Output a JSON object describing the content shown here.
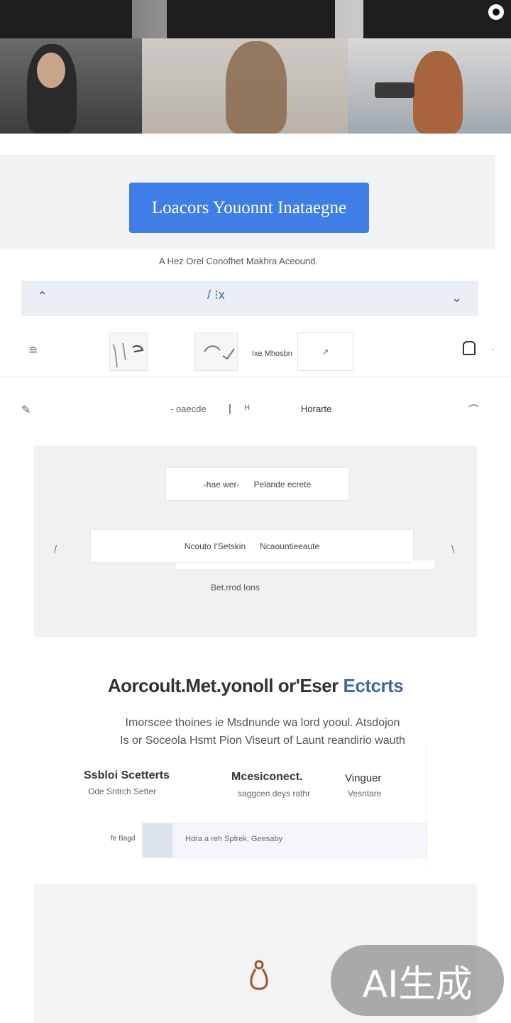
{
  "hero": {
    "alt_icon": "circle-dot-icon"
  },
  "cta": {
    "label": "Loacors Youonnt Inataegne"
  },
  "subtitle": "A Hez Orel Conofhet Makhra Aceound.",
  "toolbar": {
    "left_icon": "chevron-up-icon",
    "mid_text": "/ ⁝x",
    "right_icon": "chevron-down-icon"
  },
  "icon_row": {
    "menu_icon": "≘",
    "item1": "hand-icon",
    "item2": "check-curve-icon",
    "label": "Ixe Mhosbn",
    "box_text": "↗",
    "right_icon": "bookmark-icon",
    "dot": "."
  },
  "nav": {
    "left_icon": "pencil-icon",
    "item1": "- oaecde",
    "item2": "|",
    "item3": "H",
    "item4": "Horarte",
    "right_icon": "link-icon"
  },
  "panel": {
    "pill1_left": "-hae wer-",
    "pill1_right": "Pelande ecrete",
    "pill2_left": "Ncouto I'Setskin",
    "pill2_right": "Ncaountieeaute",
    "caption": "Bet.rrod Ions",
    "left_arrow": "/",
    "right_arrow": "\\"
  },
  "feature": {
    "title": "Aorcoult.Met.yonoll or'Eser",
    "title_accent": "Ectcrts",
    "para1": "Imorscee thoines ie Msdnunde wa lord yooul. Atsdojon",
    "para2": "Is or Soceola Hsmt Pion Viseurt of Launt reandirio wauth"
  },
  "columns": [
    {
      "title": "Ssbloi Scetterts",
      "sub": "Ode  Sntrch  Setter"
    },
    {
      "title": "Mcesiconect.",
      "sub": "saggcen  deys  rathr"
    },
    {
      "title": "Vinguer",
      "sub": "Vesntare"
    }
  ],
  "row": {
    "label": "fe Bagd",
    "text": "Hdra a reh  Spfrek. Geesaby"
  },
  "panel2": {
    "icon": "pear-icon"
  },
  "watermark": "AI生成"
}
